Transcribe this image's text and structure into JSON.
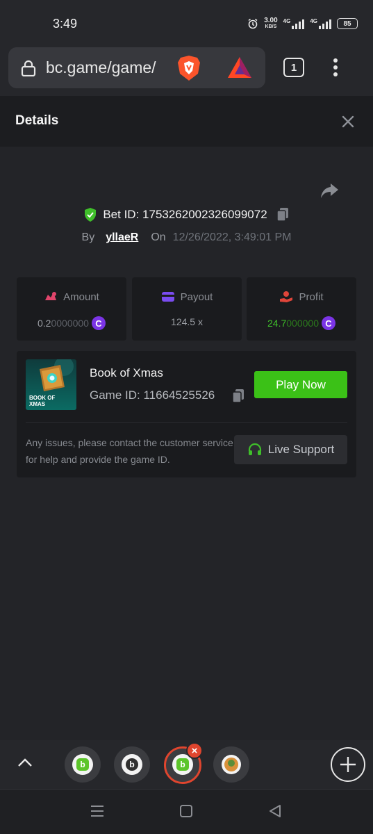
{
  "status_bar": {
    "time": "3:49",
    "net_speed_value": "3.00",
    "net_speed_unit": "KB/S",
    "net_type_1": "4G",
    "net_type_2": "4G",
    "battery": "85"
  },
  "browser": {
    "url": "bc.game/game/",
    "tab_count": "1"
  },
  "details": {
    "title": "Details",
    "bet_id_label": "Bet ID:",
    "bet_id": "1753262002326099072",
    "by_label": "By",
    "username": "yllaeR",
    "on_label": "On",
    "date": "12/26/2022, 3:49:01 PM"
  },
  "stats": {
    "amount": {
      "label": "Amount",
      "value_main": "0.2",
      "value_dim": "0000000",
      "currency_icon": "coin-icon"
    },
    "payout": {
      "label": "Payout",
      "value": "124.5 x"
    },
    "profit": {
      "label": "Profit",
      "value_main": "24.7",
      "value_dim": "000000",
      "currency_icon": "coin-icon"
    }
  },
  "game": {
    "name": "Book of Xmas",
    "game_id_label": "Game ID:",
    "game_id": "11664525526",
    "thumbnail_text_1": "BOOK OF",
    "thumbnail_text_2": "XMAS",
    "play_label": "Play Now",
    "support_text": "Any issues, please contact the customer service for help and provide the game ID.",
    "support_label": "Live Support"
  },
  "colors": {
    "accent_green": "#3bc117",
    "profit_green": "#3fbf2a",
    "coin_purple": "#7b34e6",
    "amount_pink": "#e0456b",
    "payout_purple": "#7a4cf0",
    "profit_red": "#e0453a",
    "close_tab_red": "#e0452e"
  }
}
